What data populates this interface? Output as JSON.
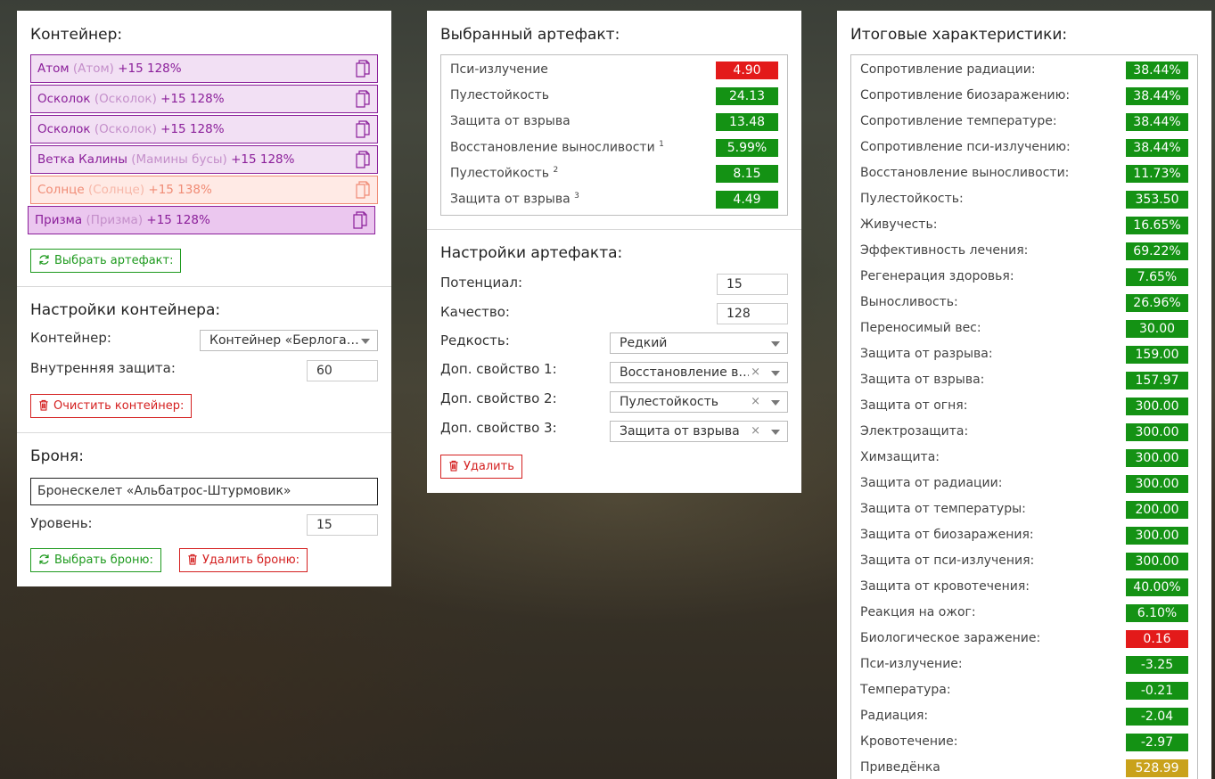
{
  "colors": {
    "green": "#149214",
    "red": "#e31a1a",
    "yellow": "#c9a21b",
    "purple": "#8b1f9a",
    "salmon": "#f08b75"
  },
  "container_panel": {
    "title": "Контейнер:",
    "artifacts": [
      {
        "name": "Атом",
        "alt": "(Атом)",
        "level": "+15 128%"
      },
      {
        "name": "Осколок",
        "alt": "(Осколок)",
        "level": "+15 128%"
      },
      {
        "name": "Осколок",
        "alt": "(Осколок)",
        "level": "+15 128%"
      },
      {
        "name": "Ветка Калины",
        "alt": "(Мамины бусы)",
        "level": "+15 128%"
      },
      {
        "name": "Солнце",
        "alt": "(Солнце)",
        "level": "+15 138%"
      },
      {
        "name": "Призма",
        "alt": "(Призма)",
        "level": "+15 128%"
      }
    ],
    "select_artifact_button": "Выбрать артефакт:",
    "settings_title": "Настройки контейнера:",
    "container_label": "Контейнер:",
    "container_value": "Контейнер «Берлога…",
    "inner_protection_label": "Внутренняя защита:",
    "inner_protection_value": "60",
    "clear_button": "Очистить контейнер:",
    "armor_title": "Броня:",
    "armor_value": "Бронескелет «Альбатрос-Штурмовик»",
    "level_label": "Уровень:",
    "level_value": "15",
    "select_armor_button": "Выбрать броню:",
    "delete_armor_button": "Удалить броню:"
  },
  "artifact_panel": {
    "title": "Выбранный артефакт:",
    "stats": [
      {
        "name": "Пси-излучение",
        "sup": "",
        "value": "4.90",
        "color": "r"
      },
      {
        "name": "Пулестойкость",
        "sup": "",
        "value": "24.13",
        "color": "g"
      },
      {
        "name": "Защита от взрыва",
        "sup": "",
        "value": "13.48",
        "color": "g"
      },
      {
        "name": "Восстановление выносливости",
        "sup": "1",
        "value": "5.99%",
        "color": "g"
      },
      {
        "name": "Пулестойкость",
        "sup": "2",
        "value": "8.15",
        "color": "g"
      },
      {
        "name": "Защита от взрыва",
        "sup": "3",
        "value": "4.49",
        "color": "g"
      }
    ],
    "settings_title": "Настройки артефакта:",
    "potential_label": "Потенциал:",
    "potential_value": "15",
    "quality_label": "Качество:",
    "quality_value": "128",
    "rarity_label": "Редкость:",
    "rarity_value": "Редкий",
    "extra1_label": "Доп. свойство 1:",
    "extra1_value": "Восстановление в…",
    "extra2_label": "Доп. свойство 2:",
    "extra2_value": "Пулестойкость",
    "extra3_label": "Доп. свойство 3:",
    "extra3_value": "Защита от взрыва",
    "delete_button": "Удалить"
  },
  "totals_panel": {
    "title": "Итоговые характеристики:",
    "stats": [
      {
        "name": "Сопротивление радиации:",
        "value": "38.44%",
        "color": "g"
      },
      {
        "name": "Сопротивление биозаражению:",
        "value": "38.44%",
        "color": "g"
      },
      {
        "name": "Сопротивление температуре:",
        "value": "38.44%",
        "color": "g"
      },
      {
        "name": "Сопротивление пси-излучению:",
        "value": "38.44%",
        "color": "g"
      },
      {
        "name": "Восстановление выносливости:",
        "value": "11.73%",
        "color": "g"
      },
      {
        "name": "Пулестойкость:",
        "value": "353.50",
        "color": "g"
      },
      {
        "name": "Живучесть:",
        "value": "16.65%",
        "color": "g"
      },
      {
        "name": "Эффективность лечения:",
        "value": "69.22%",
        "color": "g"
      },
      {
        "name": "Регенерация здоровья:",
        "value": "7.65%",
        "color": "g"
      },
      {
        "name": "Выносливость:",
        "value": "26.96%",
        "color": "g"
      },
      {
        "name": "Переносимый вес:",
        "value": "30.00",
        "color": "g"
      },
      {
        "name": "Защита от разрыва:",
        "value": "159.00",
        "color": "g"
      },
      {
        "name": "Защита от взрыва:",
        "value": "157.97",
        "color": "g"
      },
      {
        "name": "Защита от огня:",
        "value": "300.00",
        "color": "g"
      },
      {
        "name": "Электрозащита:",
        "value": "300.00",
        "color": "g"
      },
      {
        "name": "Химзащита:",
        "value": "300.00",
        "color": "g"
      },
      {
        "name": "Защита от радиации:",
        "value": "300.00",
        "color": "g"
      },
      {
        "name": "Защита от температуры:",
        "value": "200.00",
        "color": "g"
      },
      {
        "name": "Защита от биозаражения:",
        "value": "300.00",
        "color": "g"
      },
      {
        "name": "Защита от пси-излучения:",
        "value": "300.00",
        "color": "g"
      },
      {
        "name": "Защита от кровотечения:",
        "value": "40.00%",
        "color": "g"
      },
      {
        "name": "Реакция на ожог:",
        "value": "6.10%",
        "color": "g"
      },
      {
        "name": "Биологическое заражение:",
        "value": "0.16",
        "color": "r"
      },
      {
        "name": "Пси-излучение:",
        "value": "-3.25",
        "color": "g"
      },
      {
        "name": "Температура:",
        "value": "-0.21",
        "color": "g"
      },
      {
        "name": "Радиация:",
        "value": "-2.04",
        "color": "g"
      },
      {
        "name": "Кровотечение:",
        "value": "-2.97",
        "color": "g"
      },
      {
        "name": "Приведёнка",
        "value": "528.99",
        "color": "y"
      }
    ]
  }
}
